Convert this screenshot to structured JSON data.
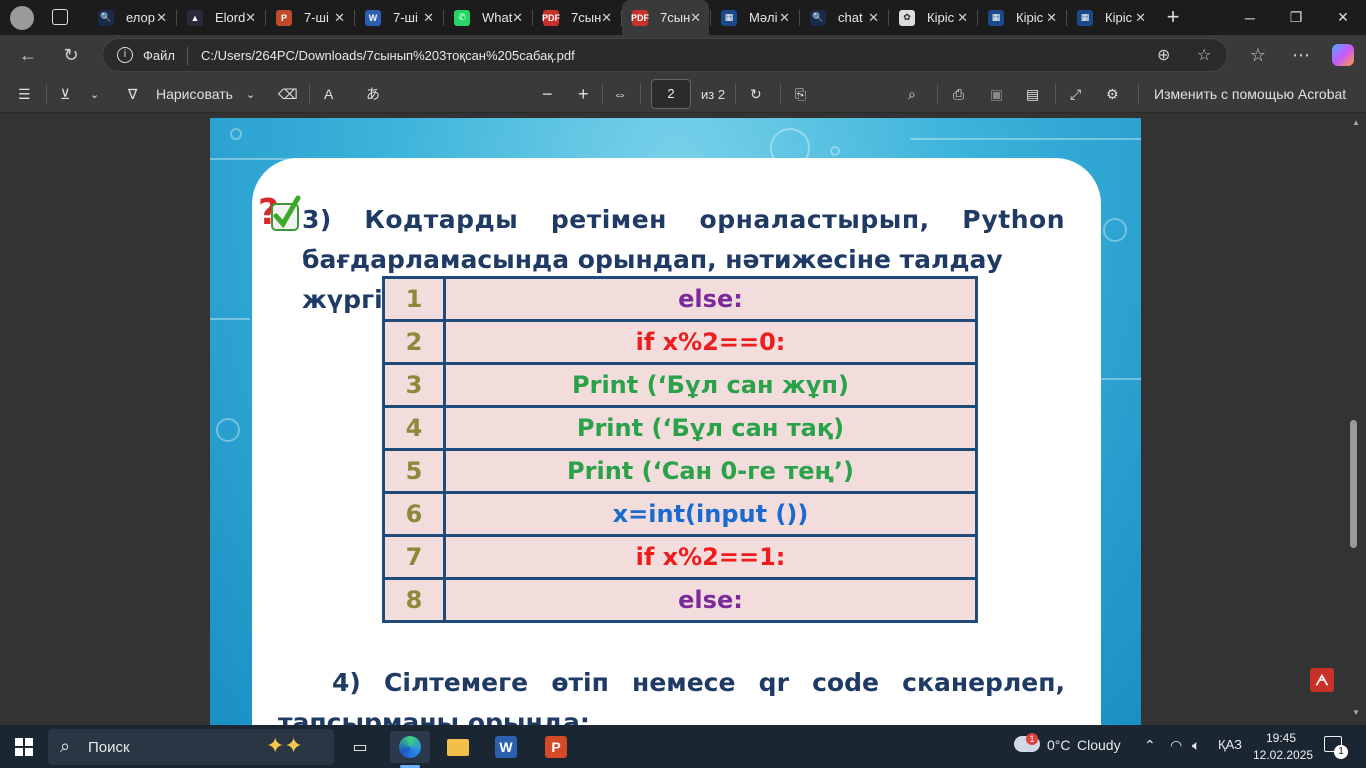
{
  "tabs": [
    {
      "title": "елор",
      "fav": "search",
      "favColor": "#1a2a4a",
      "favText": "🔍"
    },
    {
      "title": "Elord",
      "fav": "elorda",
      "favColor": "#2a2a3a",
      "favText": "▲"
    },
    {
      "title": "7-ші",
      "fav": "powerpoint",
      "favColor": "#c14a2a",
      "favText": "P"
    },
    {
      "title": "7-ші",
      "fav": "word",
      "favColor": "#2b5fb0",
      "favText": "W"
    },
    {
      "title": "What",
      "fav": "whatsapp",
      "favColor": "#25d366",
      "favText": "✆"
    },
    {
      "title": "7сын",
      "fav": "pdf",
      "favColor": "#c8302a",
      "favText": "PDF"
    },
    {
      "title": "7сын",
      "fav": "pdf",
      "favColor": "#c8302a",
      "favText": "PDF"
    },
    {
      "title": "Мәлі",
      "fav": "bilimland",
      "favColor": "#1a4a8a",
      "favText": "▦"
    },
    {
      "title": "chat",
      "fav": "search",
      "favColor": "#1a2a4a",
      "favText": "🔍"
    },
    {
      "title": "Кіріс",
      "fav": "chatgpt",
      "favColor": "#dddddd",
      "favText": "✿"
    },
    {
      "title": "Кіріс",
      "fav": "bilimland",
      "favColor": "#1a4a8a",
      "favText": "▦"
    },
    {
      "title": "Кіріс",
      "fav": "bilimland",
      "favColor": "#1a4a8a",
      "favText": "▦"
    }
  ],
  "address": {
    "file_label": "Файл",
    "url": "C:/Users/264PC/Downloads/7сынып%203тоқсан%205сабақ.pdf"
  },
  "pdf_toolbar": {
    "draw_label": "Нарисовать",
    "page_current": "2",
    "page_total": "из 2",
    "edit_acrobat": "Изменить с помощью Acrobat"
  },
  "document": {
    "q3_line1": "3) Кодтарды ретімен орналастырып, Python",
    "q3_line2": "бағдарламасында орындап, нәтижесіне талдау жүргіз:",
    "code_rows": [
      {
        "num": "1",
        "code": "else:",
        "color": "#7a2a9a"
      },
      {
        "num": "2",
        "code": "if x%2==0:",
        "color": "#ee1c1c"
      },
      {
        "num": "3",
        "code": "Print (‘Бұл сан жұп)",
        "color": "#2aa24a"
      },
      {
        "num": "4",
        "code": "Print (‘Бұл сан тақ)",
        "color": "#2aa24a"
      },
      {
        "num": "5",
        "code": "Print (‘Сан 0-ге тең’)",
        "color": "#2aa24a"
      },
      {
        "num": "6",
        "code": "x=int(input ())",
        "color": "#1a6ad0"
      },
      {
        "num": "7",
        "code": "if x%2==1:",
        "color": "#ee1c1c"
      },
      {
        "num": "8",
        "code": "else:",
        "color": "#7a2a9a"
      }
    ],
    "q4_line1": "4)   Сілтемеге өтіп немесе qr code сканерлеп,",
    "q4_line2": "тапсырманы орында:"
  },
  "taskbar": {
    "search_label": "Поиск",
    "weather_temp": "0°C",
    "weather_text": "Cloudy",
    "weather_badge": "1",
    "language": "ҚАЗ",
    "time": "19:45",
    "date": "12.02.2025",
    "notif_count": "1"
  }
}
